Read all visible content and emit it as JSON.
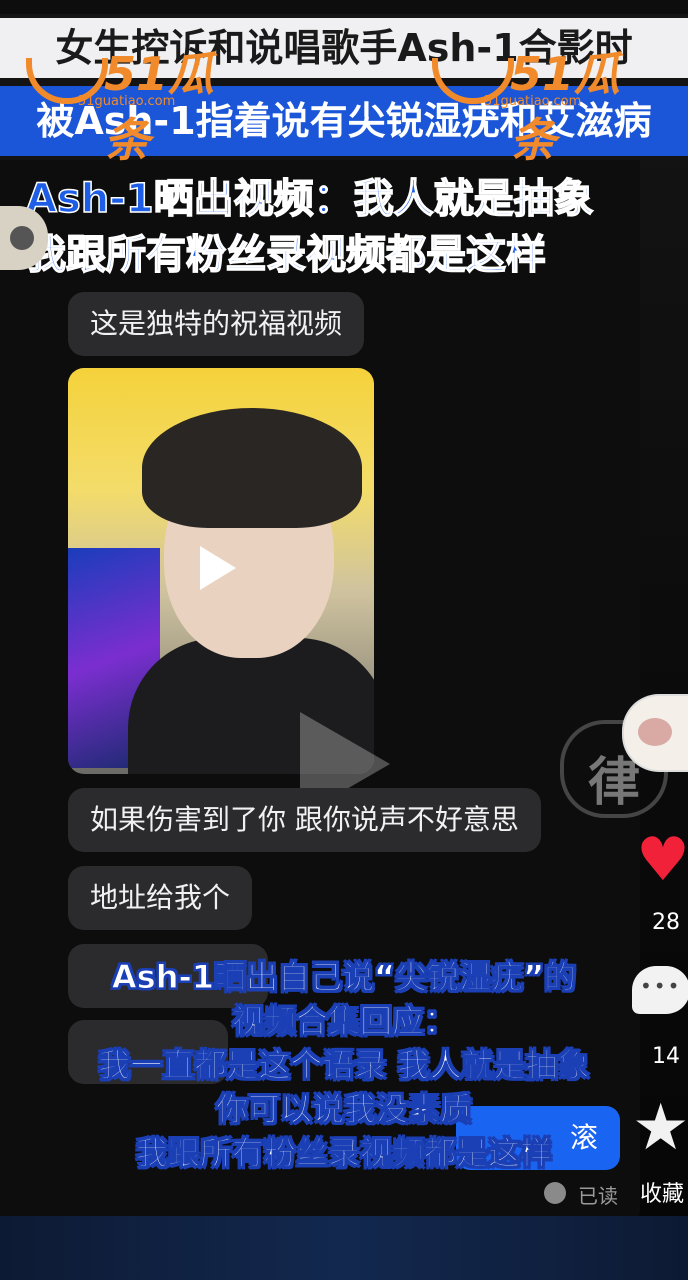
{
  "headline": {
    "line1": "女生控诉和说唱歌手Ash-1合影时",
    "line2": "被Ash-1指着说有尖锐湿疣和艾滋病",
    "line3": "Ash-1晒出视频：我人就是抽象",
    "line4": "我跟所有粉丝录视频都是这样"
  },
  "watermark": {
    "logo_text": "51瓜条",
    "url": "51guatiao.com",
    "color": "#f08a2a"
  },
  "chat": {
    "messages": [
      "这是独特的祝福视频",
      "如果伤害到了你 跟你说声不好意思",
      "地址给我个"
    ],
    "sent_message": "滚",
    "read_status": "已读"
  },
  "sidebar": {
    "like_count": "28",
    "comment_count": "14",
    "favorite_label": "收藏",
    "heart_color": "#f2213a"
  },
  "caption": {
    "lines": [
      "Ash-1晒出自己说“尖锐湿疣”的",
      "视频合集回应：",
      "我一直都是这个语录 我人就是抽象",
      "你可以说我没素质",
      "我跟所有粉丝录视频都是这样"
    ]
  },
  "colors": {
    "accent_blue": "#1b56d8",
    "bubble_bg": "#2b2b2e",
    "sent_bubble": "#1a64f2"
  }
}
